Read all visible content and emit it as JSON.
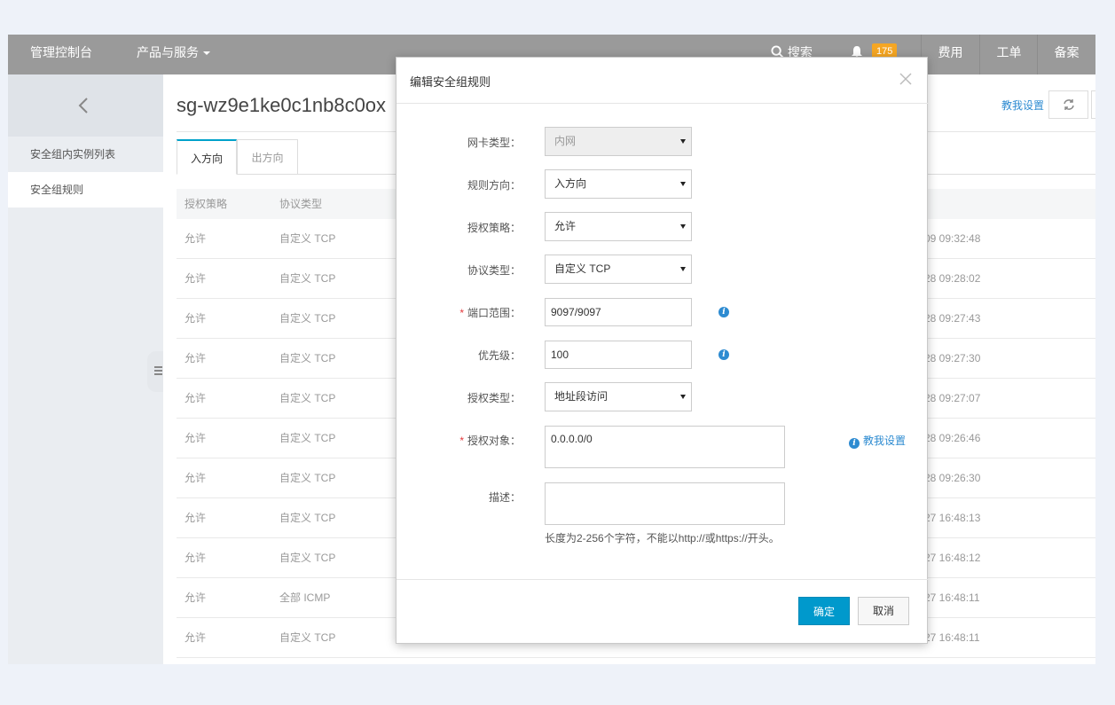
{
  "topbar": {
    "brand": "管理控制台",
    "products": "产品与服务",
    "search": "搜索",
    "notification_count": "175",
    "nav": [
      "费用",
      "工单",
      "备案"
    ]
  },
  "sidebar": {
    "items": [
      "安全组内实例列表",
      "安全组规则"
    ]
  },
  "main": {
    "title": "sg-wz9e1ke0c1nb8c0ox",
    "help_link": "教我设置",
    "tabs": [
      "入方向",
      "出方向"
    ],
    "columns": [
      "授权策略",
      "协议类型"
    ],
    "rows": [
      {
        "policy": "允许",
        "protocol": "自定义 TCP",
        "time": "09 09:32:48"
      },
      {
        "policy": "允许",
        "protocol": "自定义 TCP",
        "time": "28 09:28:02"
      },
      {
        "policy": "允许",
        "protocol": "自定义 TCP",
        "time": "28 09:27:43"
      },
      {
        "policy": "允许",
        "protocol": "自定义 TCP",
        "time": "28 09:27:30"
      },
      {
        "policy": "允许",
        "protocol": "自定义 TCP",
        "time": "28 09:27:07"
      },
      {
        "policy": "允许",
        "protocol": "自定义 TCP",
        "time": "28 09:26:46"
      },
      {
        "policy": "允许",
        "protocol": "自定义 TCP",
        "time": "28 09:26:30"
      },
      {
        "policy": "允许",
        "protocol": "自定义 TCP",
        "time": "27 16:48:13"
      },
      {
        "policy": "允许",
        "protocol": "自定义 TCP",
        "time": "27 16:48:12"
      },
      {
        "policy": "允许",
        "protocol": "全部 ICMP",
        "time": "27 16:48:11"
      },
      {
        "policy": "允许",
        "protocol": "自定义 TCP",
        "time": "27 16:48:11"
      }
    ]
  },
  "dialog": {
    "title": "编辑安全组规则",
    "fields": {
      "nic_type": {
        "label": "网卡类型：",
        "value": "内网"
      },
      "direction": {
        "label": "规则方向：",
        "value": "入方向"
      },
      "policy": {
        "label": "授权策略：",
        "value": "允许"
      },
      "protocol": {
        "label": "协议类型：",
        "value": "自定义 TCP"
      },
      "port_range": {
        "label": "端口范围：",
        "value": "9097/9097"
      },
      "priority": {
        "label": "优先级：",
        "value": "100"
      },
      "auth_type": {
        "label": "授权类型：",
        "value": "地址段访问"
      },
      "auth_object": {
        "label": "授权对象：",
        "value": "0.0.0.0/0"
      },
      "description": {
        "label": "描述：",
        "value": "",
        "hint": "长度为2-256个字符，不能以http://或https://开头。"
      }
    },
    "help_link": "教我设置",
    "ok_label": "确定",
    "cancel_label": "取消"
  },
  "colors": {
    "topbar": "#9a9a9a",
    "primary": "#0099cc",
    "link": "#2d8bd1",
    "badge": "#f5a623",
    "required": "#e4393c"
  }
}
